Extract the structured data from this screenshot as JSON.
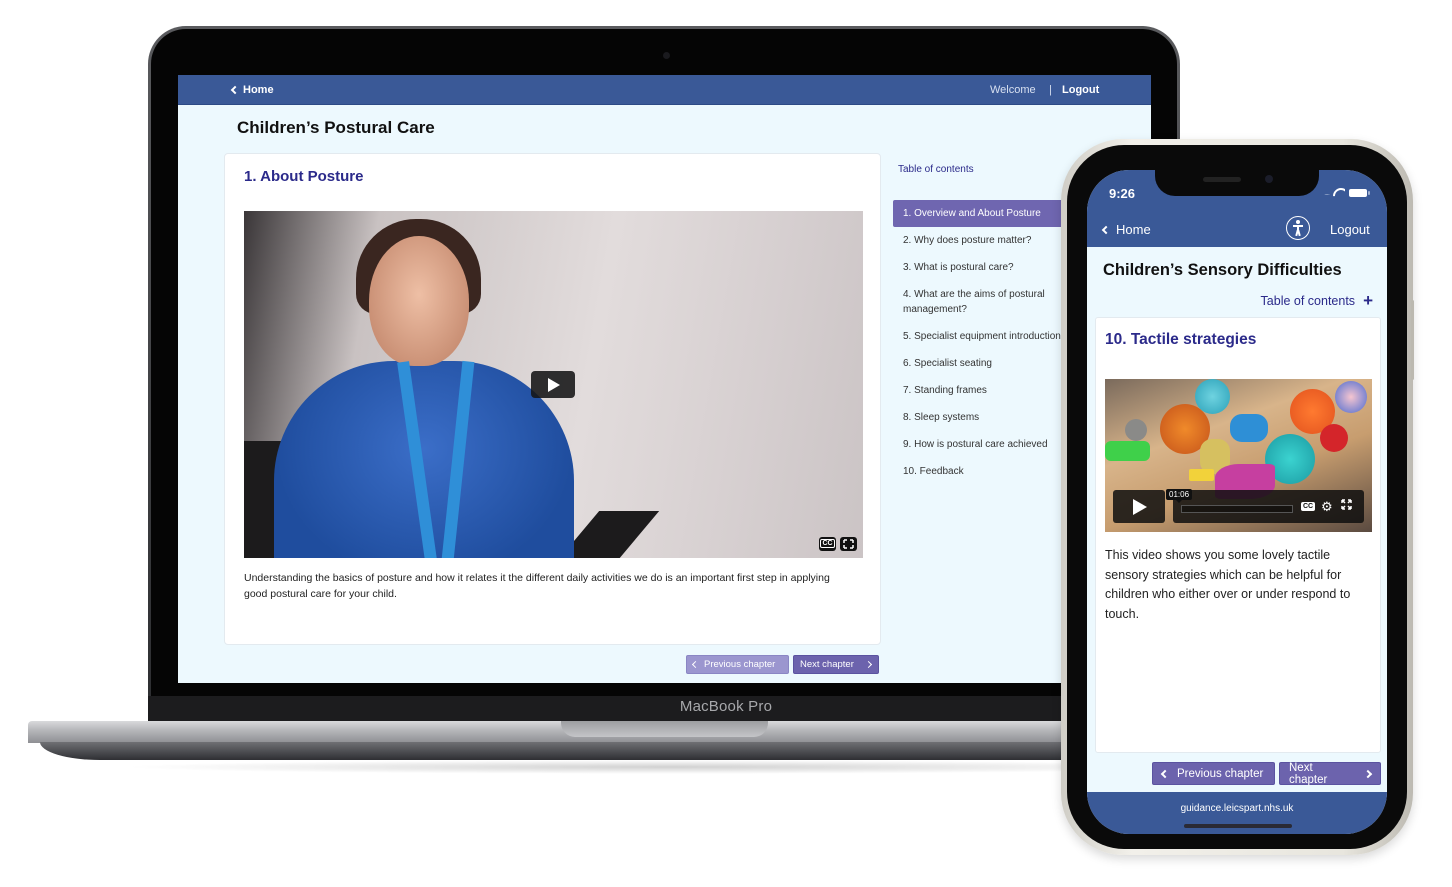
{
  "laptop": {
    "brand_label": "MacBook Pro",
    "nav": {
      "home_label": "Home",
      "welcome_label": "Welcome",
      "separator": "|",
      "logout_label": "Logout"
    },
    "page_title": "Children’s Postural Care",
    "chapter_title": "1. About Posture",
    "video": {
      "play_icon": "play-icon",
      "cc_label": "CC",
      "fullscreen_icon": "fullscreen-icon"
    },
    "description": "Understanding the basics of posture and how it relates it the different daily activities we do is an important first step in applying good postural care for your child.",
    "buttons": {
      "previous_label": "Previous chapter",
      "next_label": "Next chapter"
    },
    "toc": {
      "label": "Table of contents",
      "items": [
        {
          "label": "1. Overview and About Posture",
          "active": true
        },
        {
          "label": "2. Why does posture matter?"
        },
        {
          "label": "3. What is postural care?"
        },
        {
          "label": "4. What are the aims of postural management?"
        },
        {
          "label": "5. Specialist equipment introduction"
        },
        {
          "label": "6. Specialist seating"
        },
        {
          "label": "7. Standing frames"
        },
        {
          "label": "8. Sleep systems"
        },
        {
          "label": "9. How is postural care achieved"
        },
        {
          "label": "10. Feedback"
        }
      ]
    }
  },
  "phone": {
    "status_bar": {
      "time": "9:26",
      "signal_dots": "....",
      "wifi_icon": "wifi-icon",
      "battery_icon": "battery-icon"
    },
    "nav": {
      "home_label": "Home",
      "accessibility_icon": "accessibility-icon",
      "logout_label": "Logout"
    },
    "page_title": "Children’s Sensory Difficulties",
    "toc_label": "Table of contents",
    "toc_toggle": "+",
    "chapter_title": "10. Tactile strategies",
    "video": {
      "time_label": "01:06",
      "cc_label": "CC",
      "gear_icon": "⚙",
      "fullscreen_icon": "⛶"
    },
    "description": "This video shows you some lovely tactile sensory strategies which can be helpful for children who either over or under respond to touch.",
    "buttons": {
      "previous_label": "Previous chapter",
      "next_label": "Next chapter"
    },
    "footer_url": "guidance.leicspart.nhs.uk"
  },
  "colors": {
    "nav_blue": "#3a5997",
    "heading_indigo": "#2b2a8a",
    "button_purple": "#6c63ad",
    "button_disabled": "#9b96cf",
    "page_bg": "#edf9fe"
  }
}
